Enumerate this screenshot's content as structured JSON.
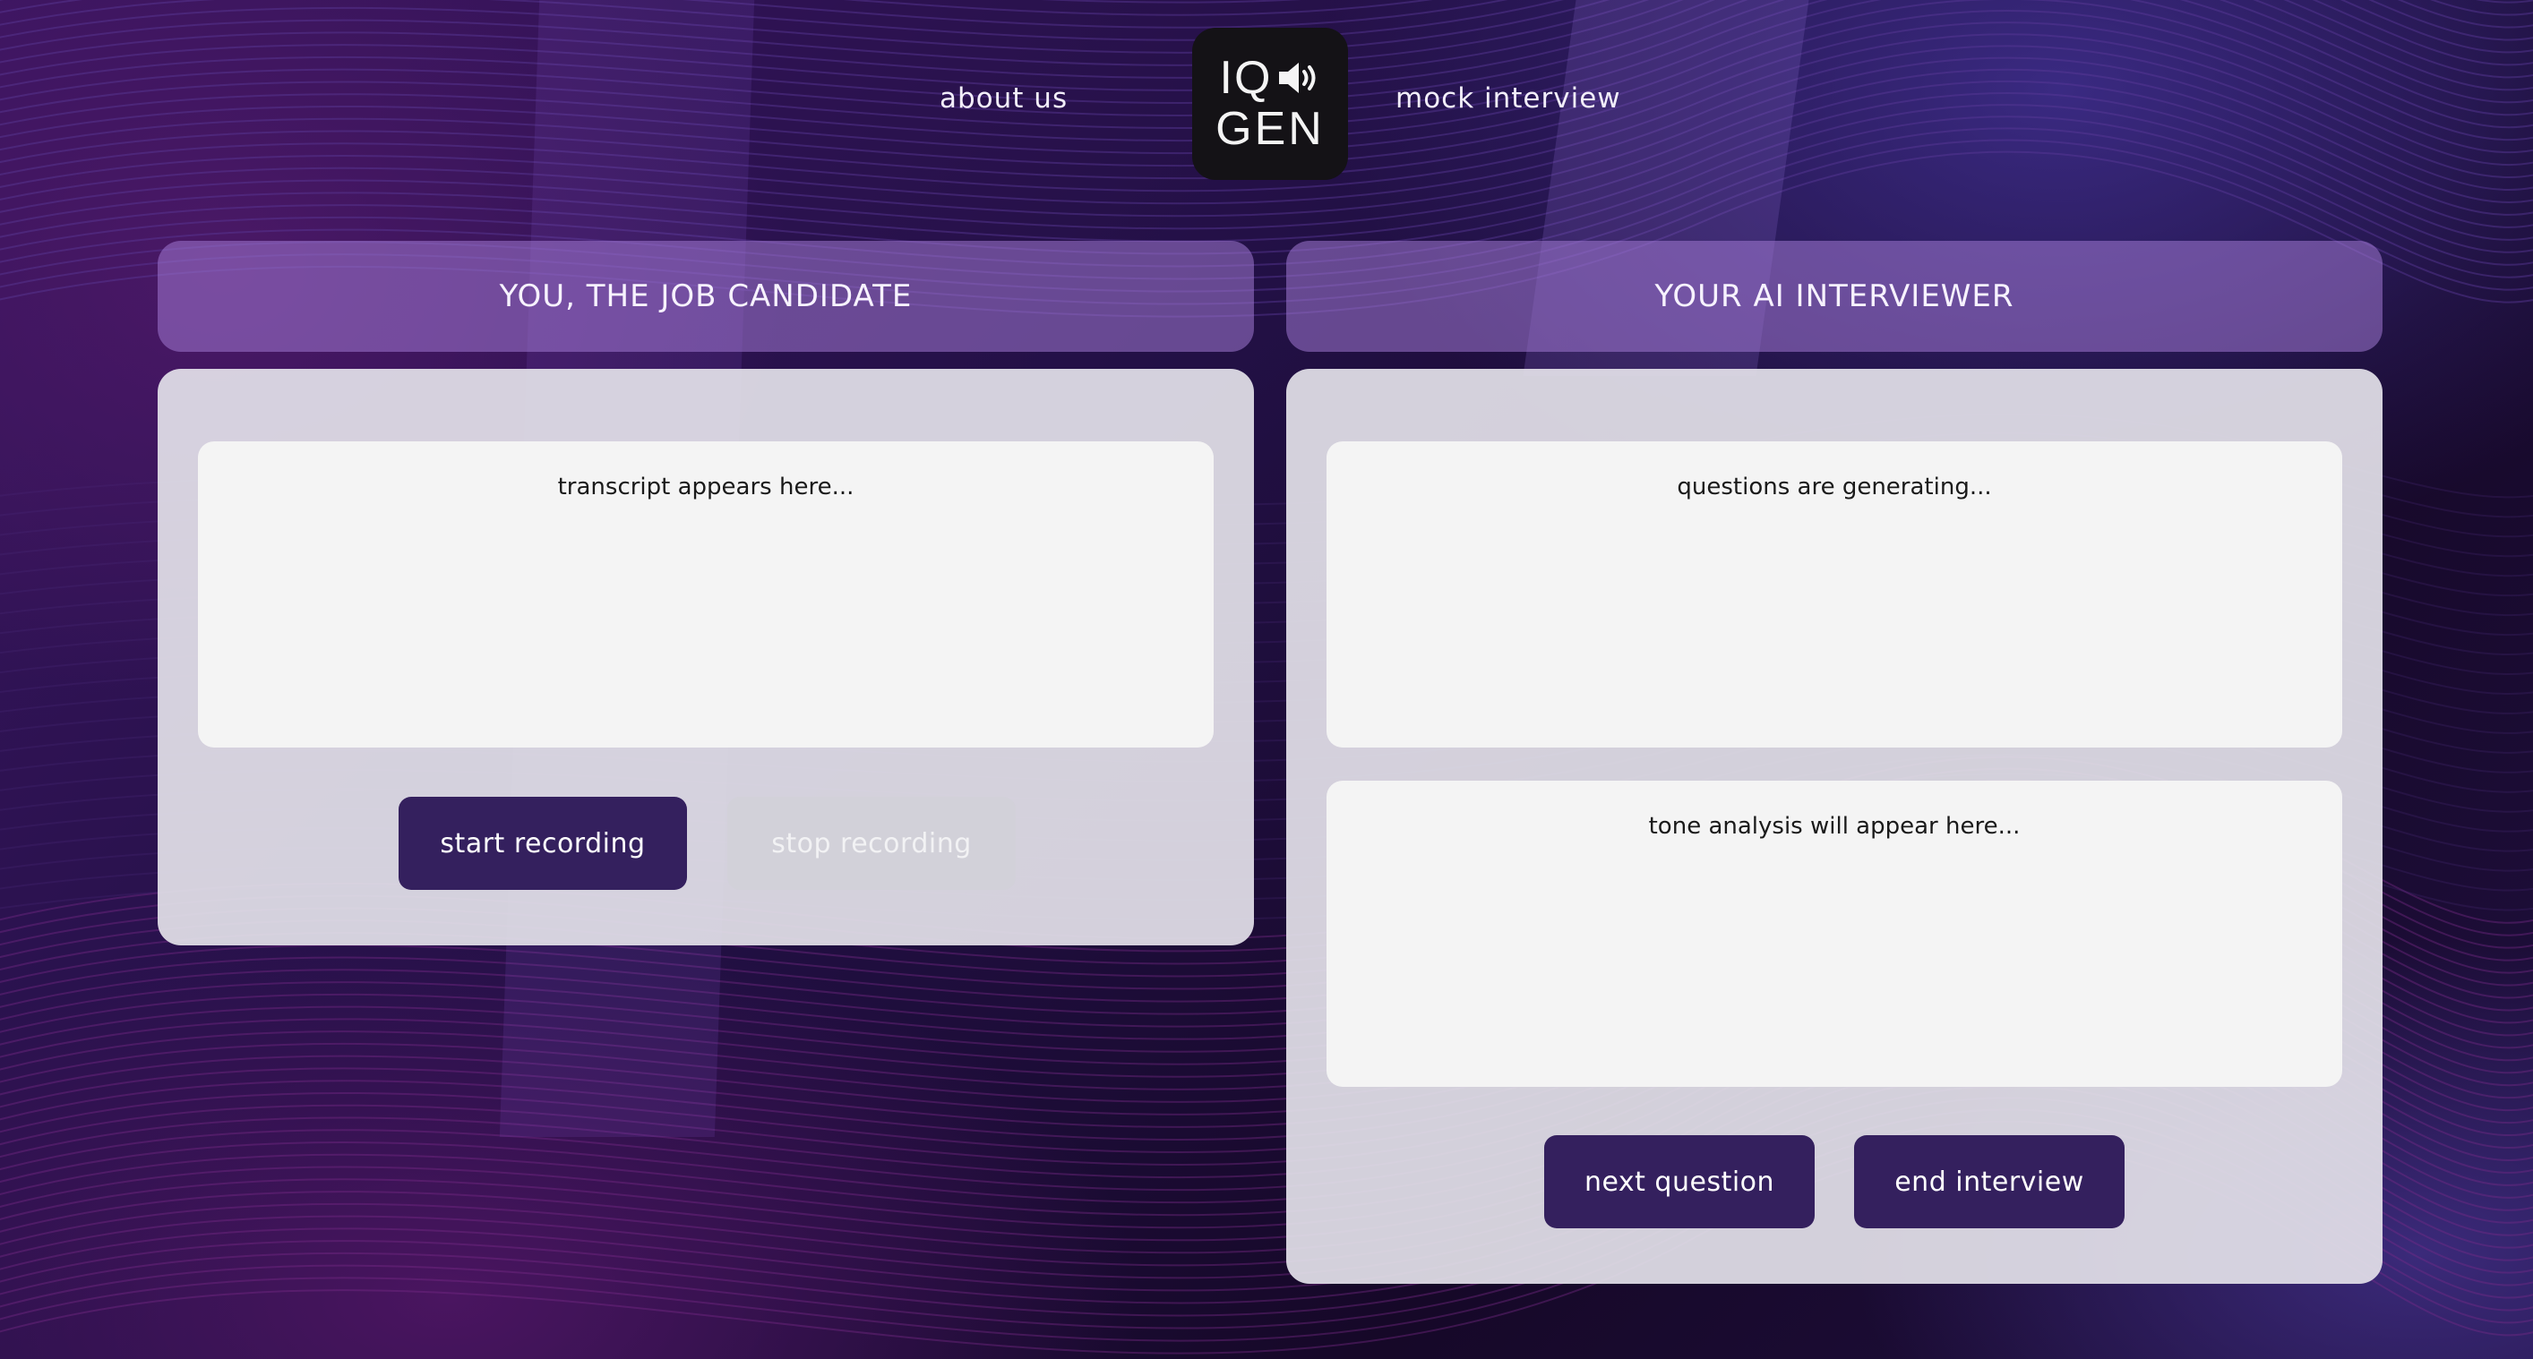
{
  "header": {
    "nav_about": "about us",
    "nav_mock": "mock interview",
    "logo": {
      "line1": "IQ",
      "line2": "GEN",
      "icon": "speaker-icon"
    }
  },
  "candidate_panel": {
    "title": "YOU, THE JOB CANDIDATE",
    "transcript_placeholder": "transcript appears here...",
    "start_button": "start recording",
    "stop_button": "stop recording"
  },
  "interviewer_panel": {
    "title": "YOUR AI INTERVIEWER",
    "questions_placeholder": "questions are generating...",
    "tone_placeholder": "tone analysis will appear here...",
    "next_button": "next question",
    "end_button": "end interview"
  },
  "colors": {
    "button": "#34205e",
    "panel_header": "#a078d2",
    "background": "#1a0830"
  }
}
